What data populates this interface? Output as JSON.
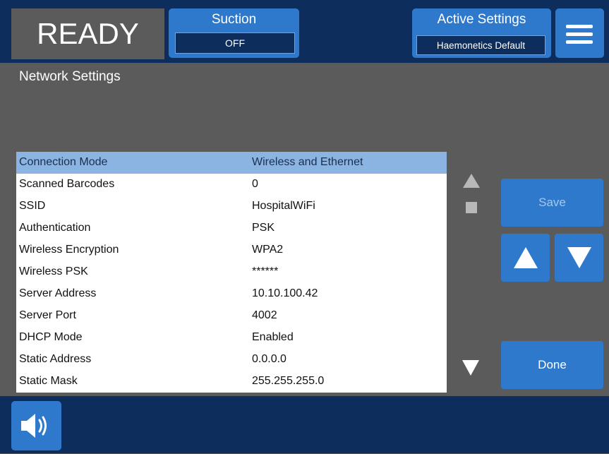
{
  "header": {
    "status": "READY",
    "suction": {
      "title": "Suction",
      "value": "OFF"
    },
    "active_settings": {
      "title": "Active Settings",
      "value": "Haemonetics Default"
    },
    "menu_icon": "hamburger-menu-icon"
  },
  "page": {
    "title": "Network Settings"
  },
  "settings": {
    "rows": [
      {
        "label": "Connection Mode",
        "value": "Wireless and Ethernet",
        "selected": true
      },
      {
        "label": "Scanned Barcodes",
        "value": "0"
      },
      {
        "label": "SSID",
        "value": "HospitalWiFi"
      },
      {
        "label": "Authentication",
        "value": "PSK"
      },
      {
        "label": "Wireless Encryption",
        "value": "WPA2"
      },
      {
        "label": "Wireless PSK",
        "value": "******"
      },
      {
        "label": "Server Address",
        "value": "10.10.100.42"
      },
      {
        "label": "Server Port",
        "value": "4002"
      },
      {
        "label": "DHCP Mode",
        "value": "Enabled"
      },
      {
        "label": "Static Address",
        "value": "0.0.0.0"
      },
      {
        "label": "Static Mask",
        "value": "255.255.255.0"
      }
    ]
  },
  "controls": {
    "save_label": "Save",
    "done_label": "Done",
    "up_icon": "arrow-up-icon",
    "down_icon": "arrow-down-icon"
  },
  "footer": {
    "speaker_icon": "speaker-volume-icon"
  },
  "colors": {
    "header_bg": "#0d2d5c",
    "button_blue": "#2f79cc",
    "body_gray": "#5b5b5b",
    "selected_row": "#8cb4e2"
  }
}
